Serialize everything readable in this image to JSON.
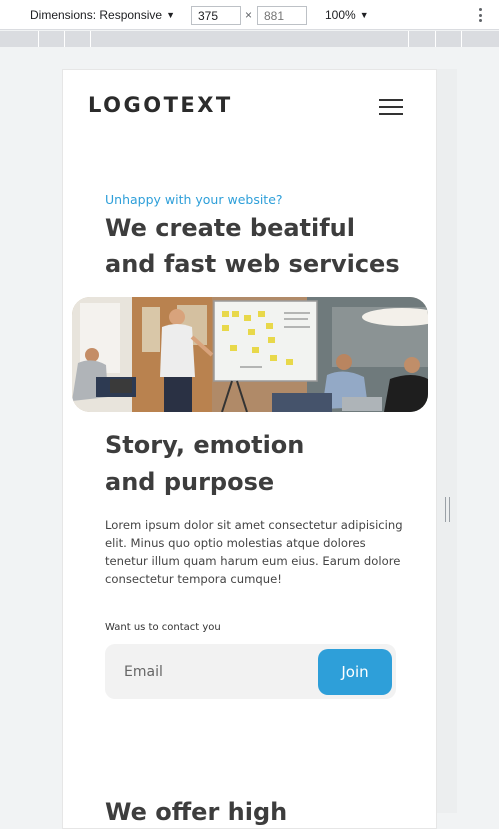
{
  "devtools": {
    "dimensions_label": "Dimensions: Responsive",
    "width_value": "375",
    "height_value": "881",
    "times": "×",
    "zoom": "100%",
    "caret": "▼"
  },
  "site": {
    "logo": "LOGOTEXT",
    "hero": {
      "eyebrow": "Unhappy with your website?",
      "title_line1": "We create beatiful",
      "title_line2": "and fast web services"
    },
    "story": {
      "title_line1": "Story, emotion",
      "title_line2": "and purpose",
      "body": "Lorem ipsum dolor sit amet consectetur adipisicing elit. Minus quo optio molestias atque dolores tenetur illum quam harum eum eius. Earum dolore consectetur tempora cumque!"
    },
    "contact": {
      "label": "Want us to contact you",
      "email_placeholder": "Email",
      "join_label": "Join"
    },
    "offer_title": "We offer high"
  },
  "colors": {
    "accent": "#2e9fd9",
    "heading": "#3d3d3d",
    "input_bg": "#f2f2f2"
  },
  "icons": [
    "caret-down-icon",
    "more-vertical-icon",
    "hamburger-menu-icon"
  ]
}
